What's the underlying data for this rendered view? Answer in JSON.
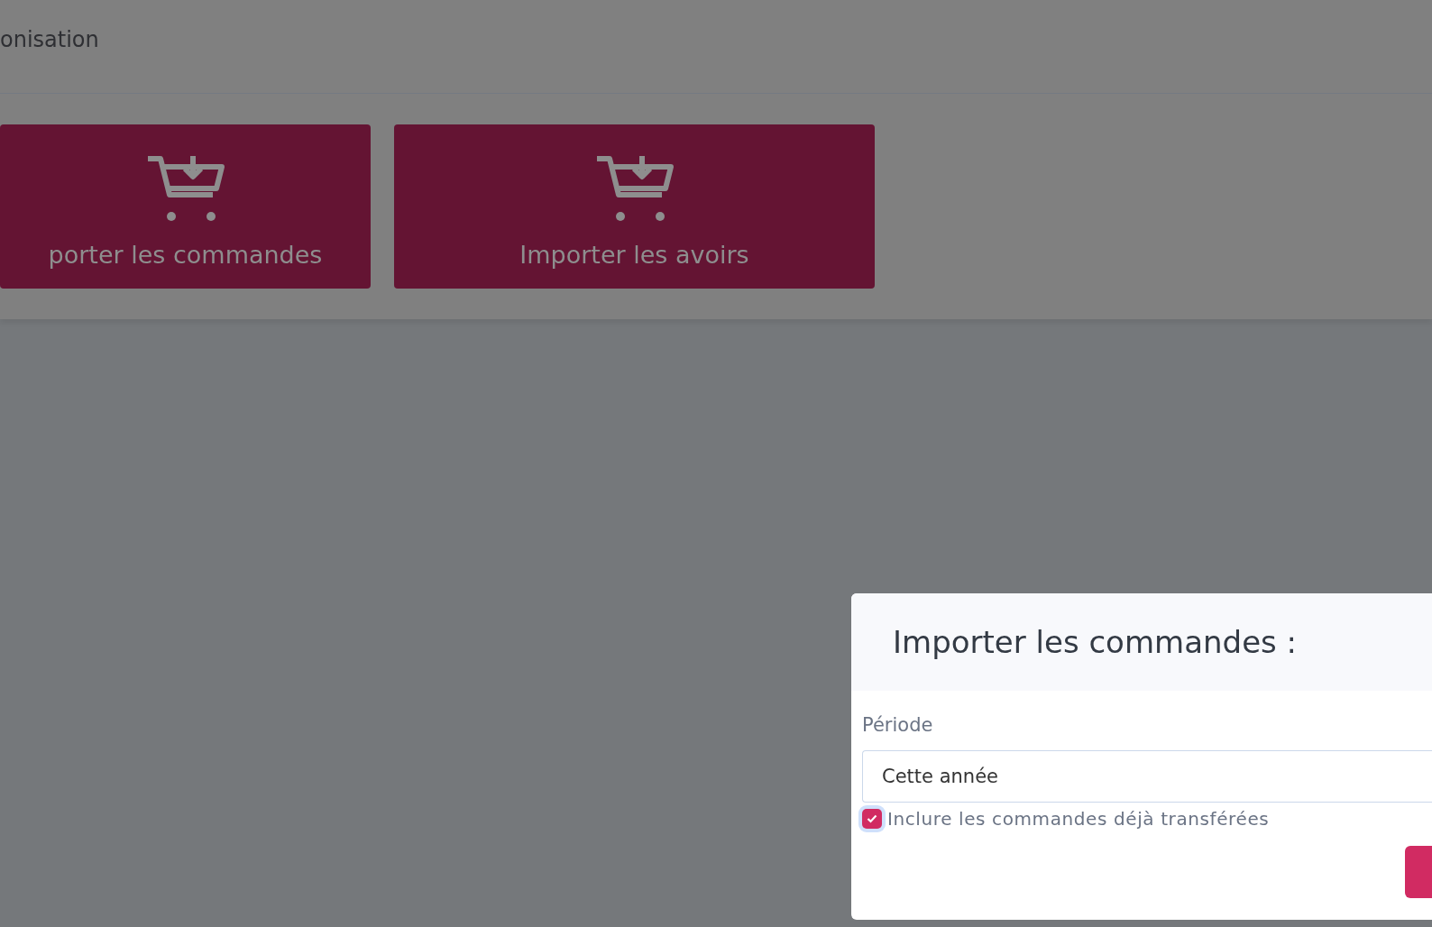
{
  "page": {
    "title": "onisation"
  },
  "actions": [
    {
      "label": "porter les commandes"
    },
    {
      "label": "Importer les avoirs"
    }
  ],
  "dialog": {
    "title": "Importer les commandes :",
    "period_label": "Période",
    "period_value": "Cette année",
    "include_transferred": {
      "label": "Inclure les commandes déjà transférées",
      "checked": true
    }
  }
}
